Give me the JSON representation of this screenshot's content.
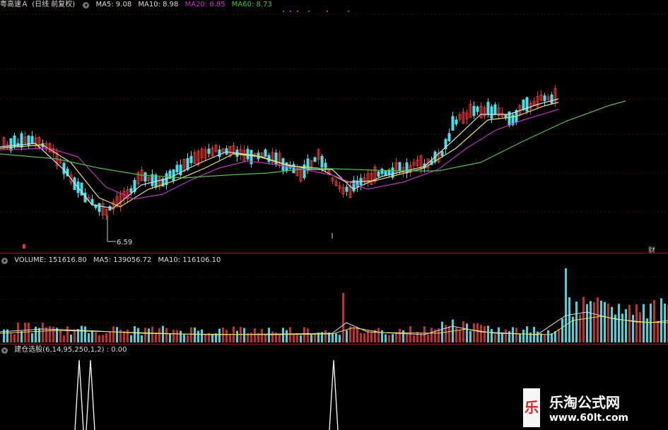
{
  "price_panel": {
    "stock_name": "粤高速Ａ",
    "period_label": "(日线 前复权)",
    "ma_items": [
      {
        "label": "MA5: 9.08",
        "color": "#dcdcdc"
      },
      {
        "label": "MA10: 8.98",
        "color": "#dcdcdc"
      },
      {
        "label": "MA20: 8.85",
        "color": "#cc33cc"
      },
      {
        "label": "MA60: 8.73",
        "color": "#22cc22"
      }
    ],
    "low_marker": "6.59",
    "right_marker": "财"
  },
  "volume_panel": {
    "title": "VOLUME: 151616.80",
    "ma5": "MA5: 139056.72",
    "ma10": "MA10: 116106.10"
  },
  "indicator_panel": {
    "title": "建仓选股(6,14,95,250,1,2) : 0.00"
  },
  "watermark": {
    "box_char": "乐",
    "title": "乐淘公式网",
    "url": "www.60lt.com"
  },
  "colors": {
    "up": "#e2372f",
    "down": "#48dfe8",
    "ma5": "#dddddd",
    "ma10": "#e6e06a",
    "ma20": "#bb33bb",
    "ma60": "#55bb55",
    "separator": "#8a1d1d"
  }
}
